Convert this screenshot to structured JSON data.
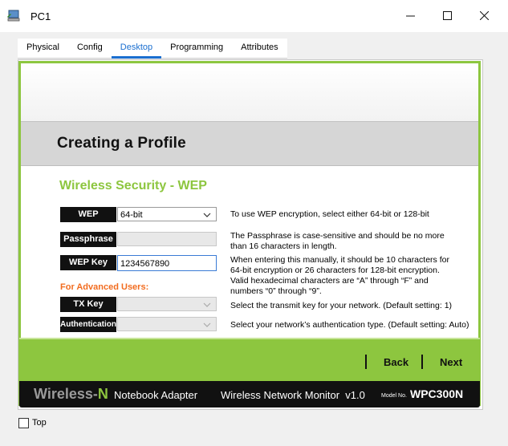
{
  "window": {
    "title": "PC1",
    "icons": {
      "app": "pc-icon",
      "minimize": "minimize-icon",
      "maximize": "maximize-icon",
      "close": "close-icon"
    }
  },
  "tabs": [
    {
      "label": "Physical",
      "active": false
    },
    {
      "label": "Config",
      "active": false
    },
    {
      "label": "Desktop",
      "active": true
    },
    {
      "label": "Programming",
      "active": false
    },
    {
      "label": "Attributes",
      "active": false
    }
  ],
  "page": {
    "title": "Creating a Profile",
    "section_heading": "Wireless Security - WEP",
    "advanced_label": "For Advanced Users:"
  },
  "form": {
    "wep": {
      "label": "WEP",
      "value": "64-bit",
      "help": "To use WEP encryption, select either 64-bit or 128-bit"
    },
    "passphrase": {
      "label": "Passphrase",
      "value": "",
      "help": "The Passphrase is case-sensitive and should be no more than 16 characters in length."
    },
    "wep_key": {
      "label": "WEP Key",
      "value": "1234567890",
      "help": "When entering this manually, it should be 10 characters for 64-bit encryption or 26 characters for 128-bit encryption. Valid hexadecimal characters are “A” through “F” and numbers “0” through “9”."
    },
    "tx_key": {
      "label": "TX Key",
      "value": "",
      "help": "Select the transmit key for your network. (Default setting: 1)"
    },
    "authentication": {
      "label": "Authentication",
      "value": "",
      "help": "Select your network’s authentication type. (Default setting: Auto)"
    }
  },
  "nav": {
    "back": "Back",
    "next": "Next"
  },
  "footer": {
    "brand_prefix": "Wireless-",
    "brand_suffix": "N",
    "product": "Notebook Adapter",
    "monitor": "Wireless Network Monitor  v1.0",
    "model_label": "Model No.",
    "model": "WPC300N"
  },
  "bottom": {
    "top_label": "Top",
    "top_checked": false
  },
  "colors": {
    "accent_green": "#8dc63f",
    "tab_blue": "#1b6fd0",
    "advanced_orange": "#f26c1f"
  }
}
